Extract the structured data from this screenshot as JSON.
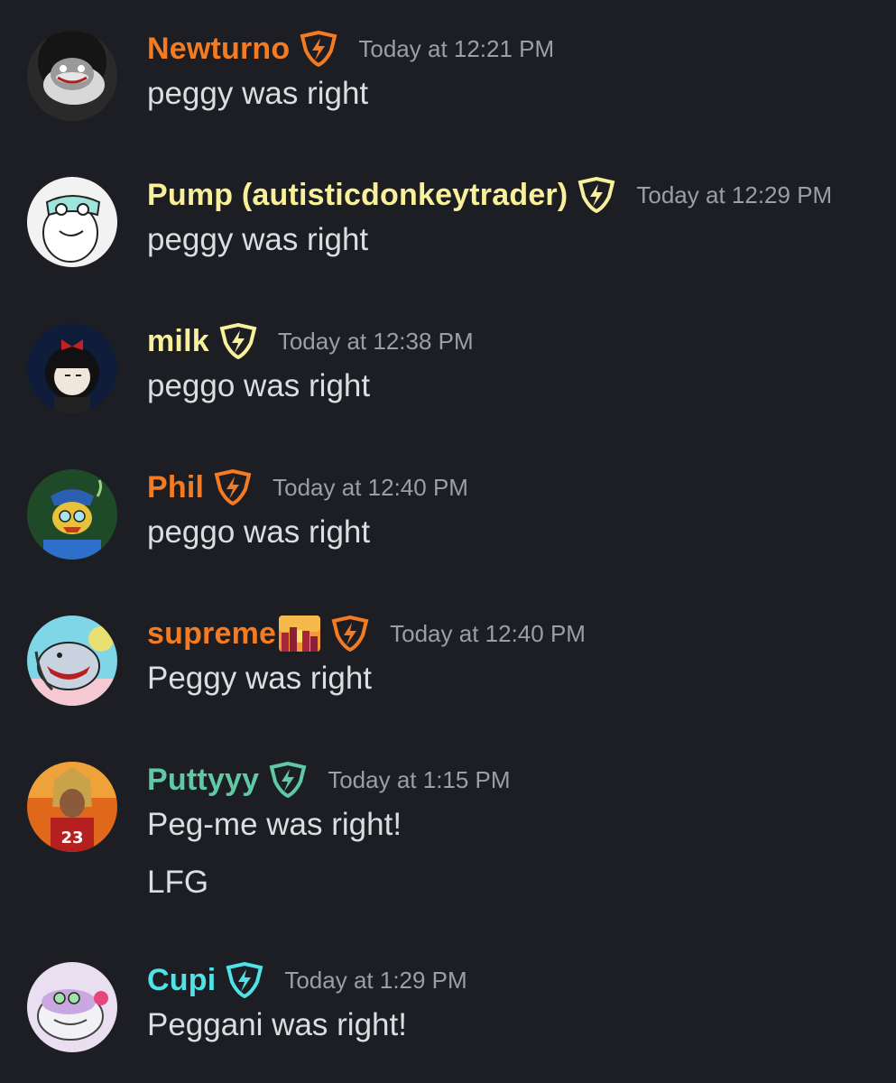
{
  "messages": [
    {
      "username": "Newturno",
      "name_color": "#f47b22",
      "badge_color": "#f47b22",
      "timestamp": "Today at 12:21 PM",
      "lines": [
        "peggy was right"
      ]
    },
    {
      "username": "Pump (autisticdonkeytrader)",
      "name_color": "#f8f09a",
      "badge_color": "#f8f09a",
      "timestamp": "Today at 12:29 PM",
      "lines": [
        "peggy was right"
      ]
    },
    {
      "username": "milk",
      "name_color": "#f8f09a",
      "badge_color": "#f8f09a",
      "timestamp": "Today at 12:38 PM",
      "lines": [
        "peggo was right"
      ]
    },
    {
      "username": "Phil",
      "name_color": "#f47b22",
      "badge_color": "#f47b22",
      "timestamp": "Today at 12:40 PM",
      "lines": [
        "peggo was right"
      ]
    },
    {
      "username": "supreme",
      "username_emoji": "sunset-city-emoji",
      "name_color": "#f47b22",
      "badge_color": "#f47b22",
      "timestamp": "Today at 12:40 PM",
      "lines": [
        "Peggy was right"
      ]
    },
    {
      "username": "Puttyyy",
      "name_color": "#5ec9a3",
      "badge_color": "#5ec9a3",
      "timestamp": "Today at 1:15 PM",
      "lines": [
        "Peg-me was right!",
        "LFG"
      ]
    },
    {
      "username": "Cupi",
      "name_color": "#4fe3e8",
      "badge_color": "#4fe3e8",
      "timestamp": "Today at 1:29 PM",
      "lines": [
        "Peggani was right!"
      ]
    }
  ],
  "icons": {
    "role_badge": "shield-lightning-icon"
  },
  "colors": {
    "background": "#1d1e23",
    "message_text": "#dbdee1",
    "timestamp_text": "#9b9ea6"
  }
}
